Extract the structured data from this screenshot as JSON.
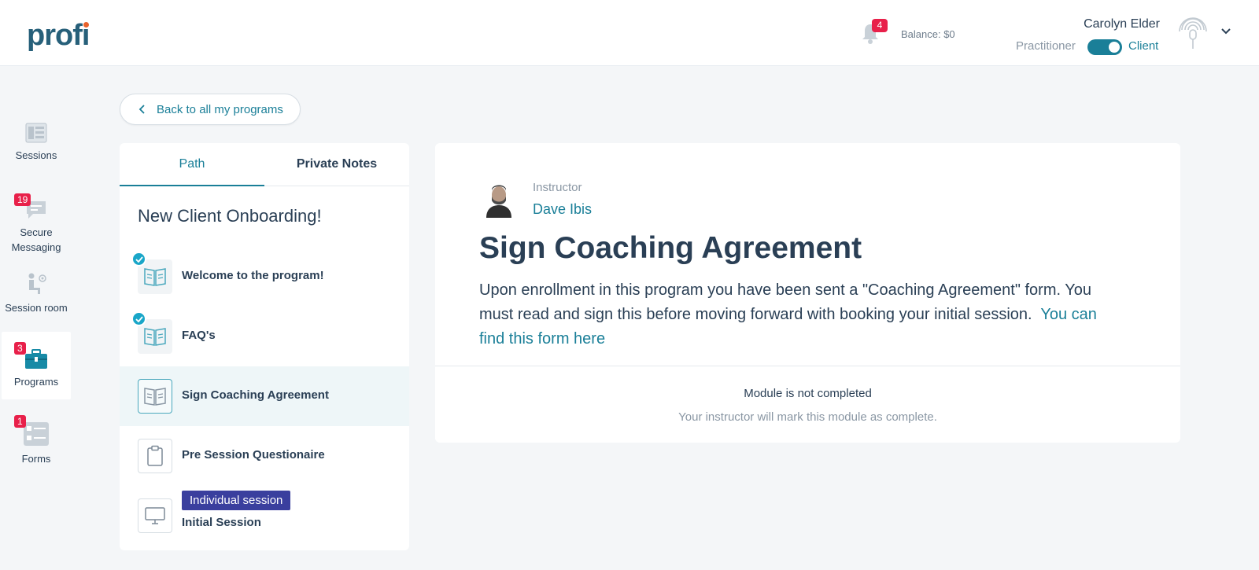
{
  "header": {
    "logo": "profi",
    "notifications_count": "4",
    "balance": "Balance: $0",
    "user_name": "Carolyn Elder",
    "role_left": "Practitioner",
    "role_right": "Client"
  },
  "sidebar": {
    "items": [
      {
        "label": "Sessions",
        "badge": ""
      },
      {
        "label": "Secure Messaging",
        "badge": "19"
      },
      {
        "label": "Session room",
        "badge": ""
      },
      {
        "label": "Programs",
        "badge": "3"
      },
      {
        "label": "Forms",
        "badge": "1"
      }
    ]
  },
  "back_button": {
    "label": "Back to all my programs"
  },
  "tabs": [
    {
      "label": "Path"
    },
    {
      "label": "Private Notes"
    }
  ],
  "program": {
    "title": "New Client Onboarding!",
    "modules": [
      {
        "label": "Welcome to the program!",
        "icon": "book-icon",
        "completed": true
      },
      {
        "label": "FAQ's",
        "icon": "book-icon",
        "completed": true
      },
      {
        "label": "Sign Coaching Agreement",
        "icon": "book-icon",
        "completed": false
      },
      {
        "label": "Pre Session Questionaire",
        "icon": "clipboard-icon",
        "completed": false
      },
      {
        "label": "Initial Session",
        "icon": "monitor-icon",
        "completed": false,
        "tag": "Individual session"
      }
    ]
  },
  "detail": {
    "instructor_role": "Instructor",
    "instructor_name": "Dave Ibis",
    "title": "Sign Coaching Agreement",
    "description": "Upon enrollment in this program you have been sent a \"Coaching Agreement\" form. You must read and sign this before moving forward with booking your initial session.",
    "link_text": "You can find this form here",
    "status_title": "Module is not completed",
    "status_subtitle": "Your instructor will mark this module as complete."
  },
  "colors": {
    "accent": "#1a7f98",
    "badge": "#e8204a",
    "tag": "#3a3f9e",
    "check": "#19a6c8"
  }
}
